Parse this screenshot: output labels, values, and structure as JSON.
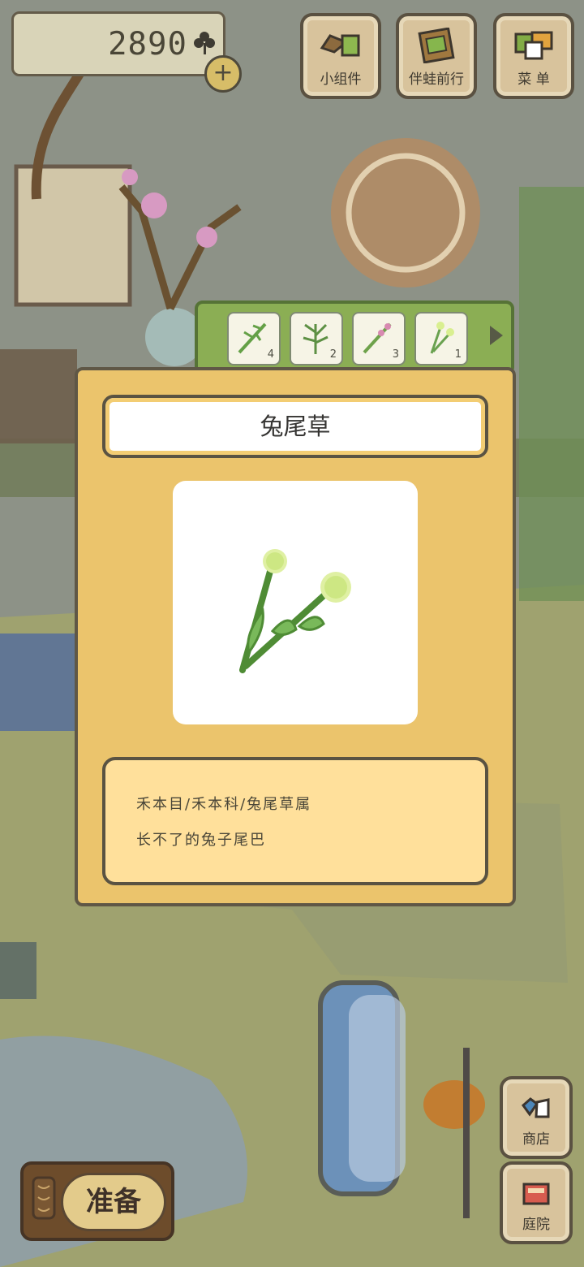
{
  "hud": {
    "clover_count": "2890",
    "top_buttons": [
      "小组件",
      "伴蛙前行",
      "菜 单"
    ]
  },
  "side_buttons": [
    "商店",
    "庭院"
  ],
  "footer": {
    "prepare_label": "准备"
  },
  "plant_strip": {
    "items": [
      {
        "count": "4",
        "icon": "sprig-icon"
      },
      {
        "count": "2",
        "icon": "coral-sprig-icon"
      },
      {
        "count": "3",
        "icon": "pink-sprig-icon"
      },
      {
        "count": "1",
        "icon": "rabbit-tail-grass-icon"
      }
    ]
  },
  "card": {
    "title": "兔尾草",
    "classification": "禾本目/禾本科/兔尾草属",
    "description": "长不了的兔子尾巴"
  },
  "colors": {
    "card_bg": "#ebc46c",
    "desc_bg": "#ffe09b",
    "strip_bg": "#8bae54"
  }
}
